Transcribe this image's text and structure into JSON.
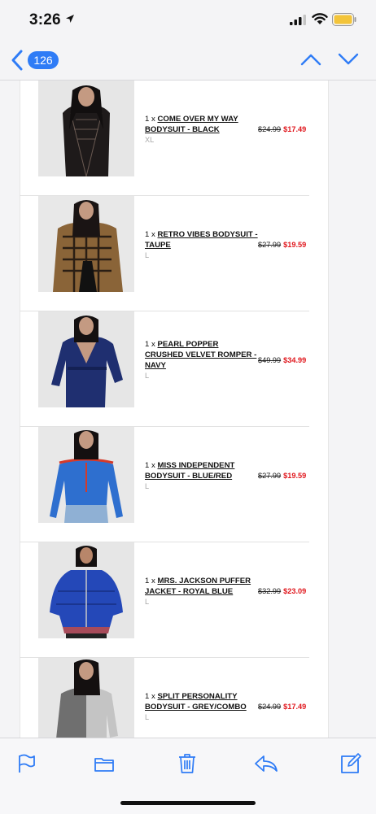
{
  "status": {
    "time": "3:26"
  },
  "nav": {
    "unread_count": "126"
  },
  "items": [
    {
      "qty": "1 x",
      "name": "COME OVER MY WAY BODYSUIT - BLACK",
      "size": "XL",
      "old_price": "$24.99",
      "new_price": "$17.49"
    },
    {
      "qty": "1 x",
      "name": "RETRO VIBES BODYSUIT - TAUPE",
      "size": "L",
      "old_price": "$27.99",
      "new_price": "$19.59"
    },
    {
      "qty": "1 x",
      "name": "PEARL POPPER CRUSHED VELVET ROMPER - NAVY",
      "size": "L",
      "old_price": "$49.99",
      "new_price": "$34.99"
    },
    {
      "qty": "1 x",
      "name": "MISS INDEPENDENT BODYSUIT - BLUE/RED",
      "size": "L",
      "old_price": "$27.99",
      "new_price": "$19.59"
    },
    {
      "qty": "1 x",
      "name": "MRS. JACKSON PUFFER JACKET - ROYAL BLUE",
      "size": "L",
      "old_price": "$32.99",
      "new_price": "$23.09"
    },
    {
      "qty": "1 x",
      "name": "SPLIT PERSONALITY BODYSUIT - GREY/COMBO",
      "size": "L",
      "old_price": "$24.99",
      "new_price": "$17.49"
    }
  ],
  "colors": {
    "accent": "#2f7cf6",
    "sale": "#e0161c"
  },
  "toolbar": {
    "icons": [
      "flag-icon",
      "folder-icon",
      "trash-icon",
      "reply-icon",
      "compose-icon"
    ]
  }
}
